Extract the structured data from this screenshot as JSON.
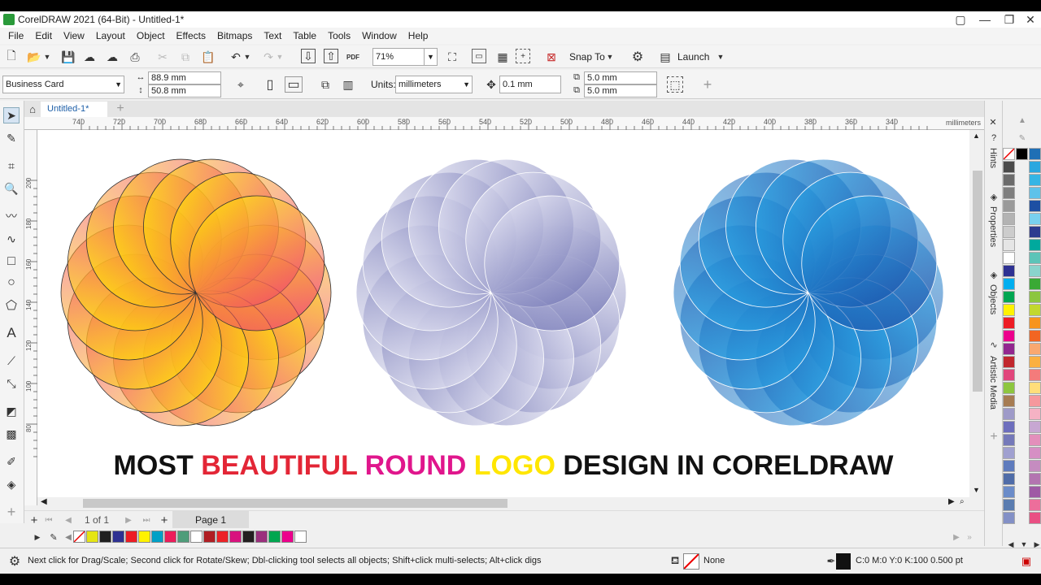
{
  "app": {
    "title": "CorelDRAW 2021 (64-Bit) - Untitled-1*",
    "window_buttons": [
      "▢",
      "—",
      "❐",
      "✕"
    ]
  },
  "menu": [
    "File",
    "Edit",
    "View",
    "Layout",
    "Object",
    "Effects",
    "Bitmaps",
    "Text",
    "Table",
    "Tools",
    "Window",
    "Help"
  ],
  "toolbar": {
    "zoom": "71%",
    "snap_to": "Snap To",
    "launch": "Launch",
    "pdf_label": "PDF"
  },
  "propertybar": {
    "page_preset": "Business Card",
    "width": "88.9 mm",
    "height": "50.8 mm",
    "units_label": "Units:",
    "units": "millimeters",
    "nudge": "0.1 mm",
    "dup_x": "5.0 mm",
    "dup_y": "5.0 mm"
  },
  "document": {
    "tab": "Untitled-1*",
    "ruler_unit": "millimeters",
    "h_ticks": [
      "740",
      "720",
      "700",
      "680",
      "660",
      "640",
      "620",
      "600",
      "580",
      "560",
      "540",
      "520",
      "500",
      "480",
      "460",
      "440",
      "420",
      "400",
      "380",
      "360",
      "340"
    ],
    "v_ticks": [
      "200",
      "180",
      "160",
      "140",
      "120",
      "100",
      "80"
    ]
  },
  "artwork": {
    "headline": [
      {
        "text": "MOST ",
        "color": "#111111"
      },
      {
        "text": "BEAUTIFUL ",
        "color": "#e32636"
      },
      {
        "text": "ROUND ",
        "color": "#e0168c"
      },
      {
        "text": "LOGO ",
        "color": "#ffe600"
      },
      {
        "text": "DESIGN IN CORELDRAW",
        "color": "#111111"
      }
    ],
    "logos": [
      {
        "name": "orange-yellow-flower",
        "stop_a": "#ffe600",
        "stop_b": "#ee2a7b",
        "stroke": "#333333"
      },
      {
        "name": "lavender-flower",
        "stop_a": "#e9e9f6",
        "stop_b": "#5b5fa8",
        "stroke": "#ffffff"
      },
      {
        "name": "blue-flower",
        "stop_a": "#28a8e8",
        "stop_b": "#1743a0",
        "stroke": "#ffffff"
      }
    ]
  },
  "pagebar": {
    "page_count": "1  of  1",
    "page_tab": "Page 1"
  },
  "dockers": [
    "Hints",
    "Properties",
    "Objects",
    "Artistic Media"
  ],
  "palette_colors": [
    "#000000",
    "#1f6fb5",
    "#4a4a4a",
    "#2aa7df",
    "#6b6b6b",
    "#35b5e5",
    "#7f7f7f",
    "#5ec2ea",
    "#9a9a9a",
    "#1d4fa3",
    "#b3b3b3",
    "#79d0ef",
    "#cccccc",
    "#2c3b8f",
    "#e5e5e5",
    "#00a99d",
    "#ffffff",
    "#5cc4b8",
    "#2e3192",
    "#8ad4cc",
    "#00aeef",
    "#3aa935",
    "#00a651",
    "#8cc63f",
    "#fff200",
    "#c2d82e",
    "#ed1c24",
    "#f7941d",
    "#ec008c",
    "#f26522",
    "#92278f",
    "#f9a870",
    "#c1272d",
    "#fbb040",
    "#e1467c",
    "#f47b7b",
    "#8dc63f",
    "#ffde7a",
    "#a67c52",
    "#f6989d",
    "#9e9ac8",
    "#f5b2c4",
    "#6d6ebd",
    "#c7a7d2",
    "#7579b9",
    "#e38fbb",
    "#a0a0d0",
    "#d68fc4",
    "#5e7bbd",
    "#c58cc0",
    "#4f6ca8",
    "#b374b0",
    "#6b8cc9",
    "#9f5aa5",
    "#5a7cb0",
    "#ed6e9b",
    "#8390c6",
    "#e94f83"
  ],
  "doc_palette": [
    "#e5e514",
    "#1f1f1f",
    "#2e3192",
    "#ed1c24",
    "#fff200",
    "#00a0c6",
    "#ec1c5a",
    "#4f9d7a",
    "#ffffff",
    "#b01e23",
    "#ec2227",
    "#d8127e",
    "#231f20",
    "#9b2f7d",
    "#00a650",
    "#ec008c",
    "#ffffff"
  ],
  "status": {
    "hint": "Next click for Drag/Scale; Second click for Rotate/Skew; Dbl-clicking tool selects all objects; Shift+click multi-selects; Alt+click digs",
    "fill": "None",
    "outline": "C:0 M:0 Y:0 K:100  0.500 pt"
  }
}
